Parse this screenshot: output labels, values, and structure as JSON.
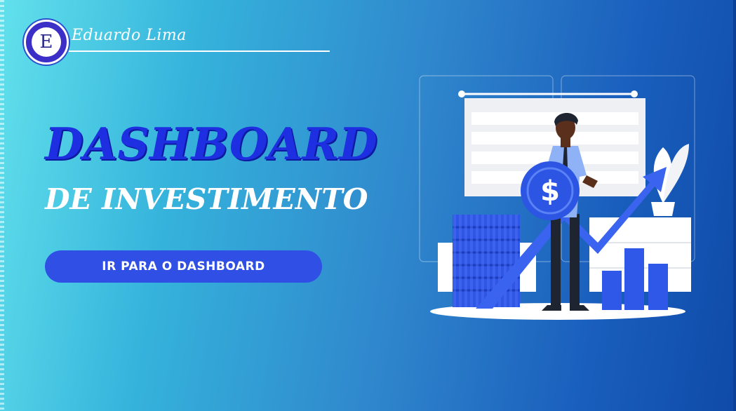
{
  "brand": {
    "logo_letter": "E",
    "name": "Eduardo Lima"
  },
  "hero": {
    "title": "DASHBOARD",
    "subtitle": "DE INVESTIMENTO",
    "cta_label": "IR PARA O DASHBOARD"
  },
  "illustration": {
    "coin_symbol": "$"
  },
  "colors": {
    "title_blue": "#1d2fe0",
    "button_blue": "#2f4fe5",
    "accent_blue": "#3a63ef",
    "background_start": "#62e1ec",
    "background_end": "#0f4aa8"
  }
}
